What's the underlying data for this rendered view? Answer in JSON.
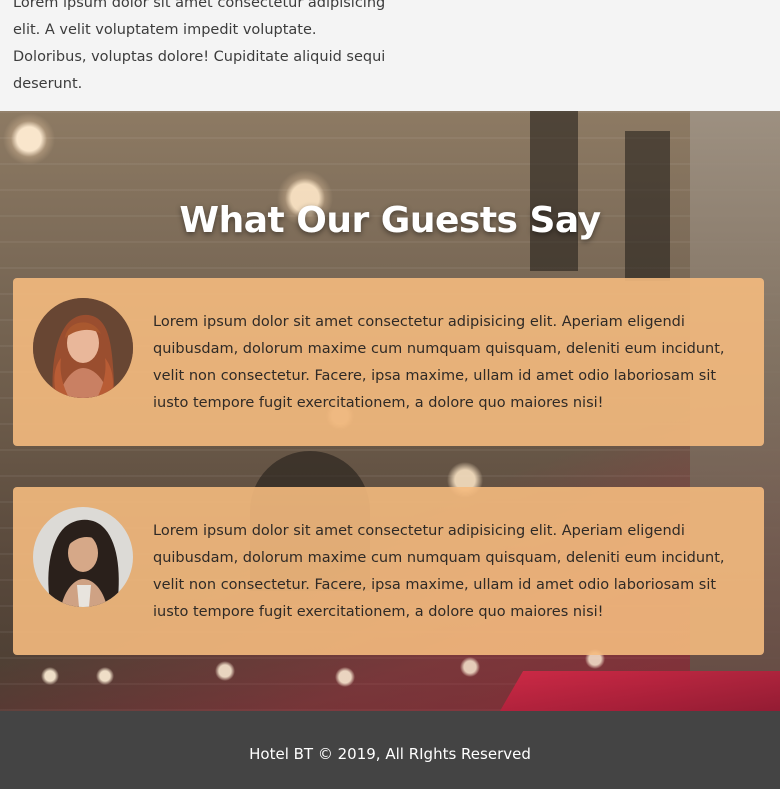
{
  "intro": {
    "text": "Lorem ipsum dolor sit amet consectetur adipisicing elit. A velit voluptatem impedit voluptate. Doloribus, voluptas dolore! Cupiditate aliquid sequi deserunt."
  },
  "testimonials": {
    "title": "What Our Guests Say",
    "items": [
      {
        "text": "Lorem ipsum dolor sit amet consectetur adipisicing elit. Aperiam eligendi quibusdam, dolorum maxime cum numquam quisquam, deleniti eum incidunt, velit non consectetur. Facere, ipsa maxime, ullam id amet odio laboriosam sit iusto tempore fugit exercitationem, a dolore quo maiores nisi!"
      },
      {
        "text": "Lorem ipsum dolor sit amet consectetur adipisicing elit. Aperiam eligendi quibusdam, dolorum maxime cum numquam quisquam, deleniti eum incidunt, velit non consectetur. Facere, ipsa maxime, ullam id amet odio laboriosam sit iusto tempore fugit exercitationem, a dolore quo maiores nisi!"
      }
    ]
  },
  "footer": {
    "copyright": "Hotel BT © 2019, All RIghts Reserved"
  },
  "colors": {
    "card_background": "#f4ba7e",
    "footer_background": "#444444",
    "intro_background": "#f4f4f4"
  }
}
